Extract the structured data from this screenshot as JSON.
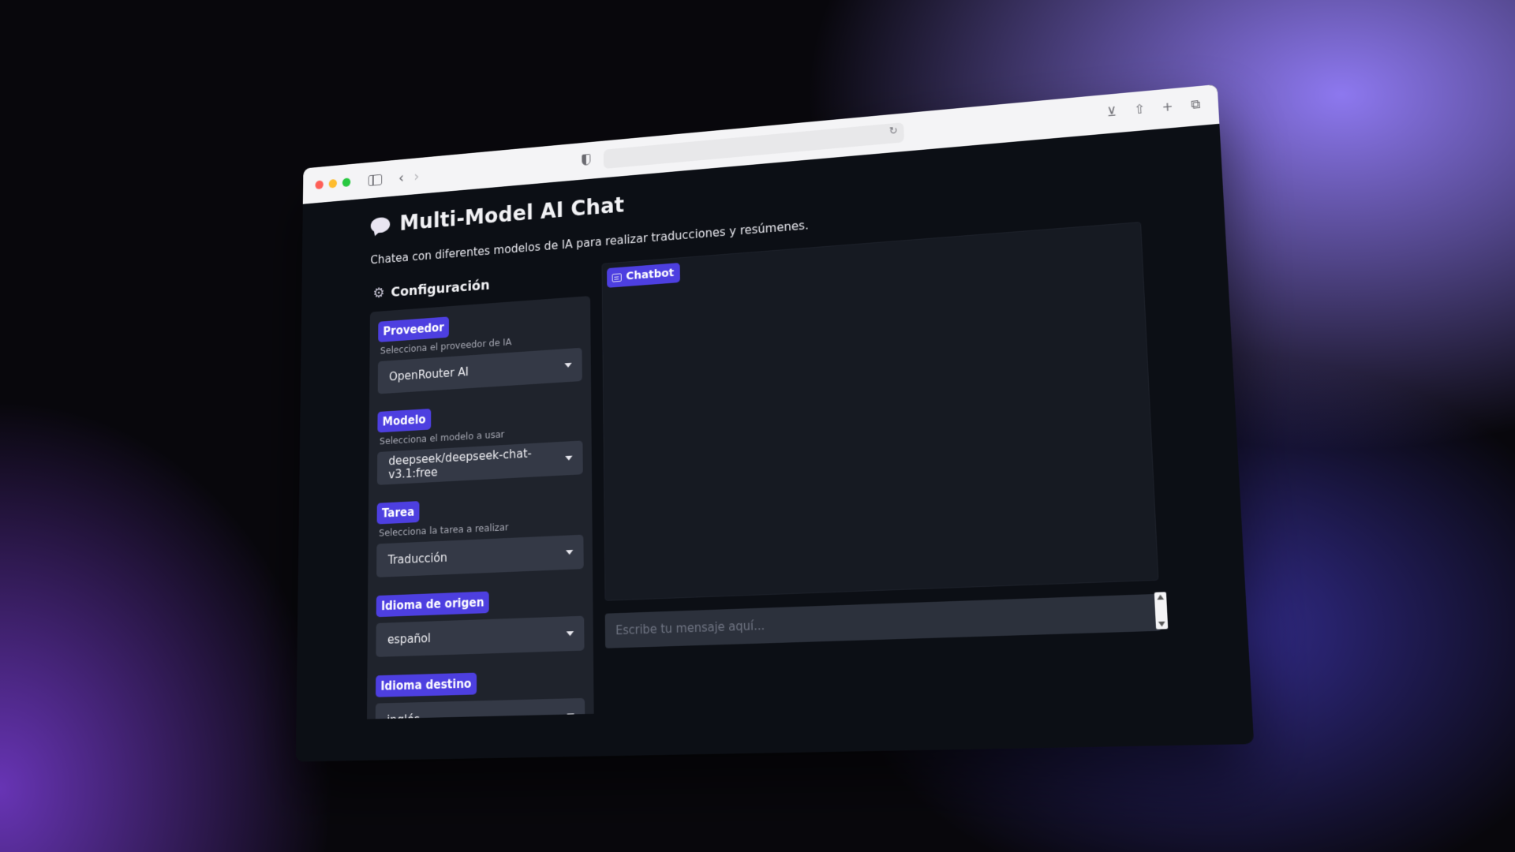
{
  "app": {
    "title": "Multi-Model AI Chat",
    "subtitle": "Chatea con diferentes modelos de IA para realizar traducciones y resúmenes."
  },
  "config": {
    "heading": "Configuración",
    "fields": [
      {
        "label": "Proveedor",
        "hint": "Selecciona el proveedor de IA",
        "value": "OpenRouter AI"
      },
      {
        "label": "Modelo",
        "hint": "Selecciona el modelo a usar",
        "value": "deepseek/deepseek-chat-v3.1:free"
      },
      {
        "label": "Tarea",
        "hint": "Selecciona la tarea a realizar",
        "value": "Traducción"
      },
      {
        "label": "Idioma de origen",
        "hint": "",
        "value": "español"
      },
      {
        "label": "Idioma destino",
        "hint": "",
        "value": "inglés"
      }
    ]
  },
  "chat": {
    "label": "Chatbot",
    "input_placeholder": "Escribe tu mensaje aquí..."
  },
  "colors": {
    "accent": "#4d3fe0",
    "page_bg": "#0c0f15",
    "panel_bg": "#1f232c"
  },
  "icons": [
    "sidebar-toggle-icon",
    "back-chevron-icon",
    "forward-chevron-icon",
    "shield-icon",
    "reload-icon",
    "download-icon",
    "share-icon",
    "new-tab-icon",
    "tabs-overview-icon",
    "speech-bubble-icon",
    "gear-icon",
    "message-icon"
  ]
}
